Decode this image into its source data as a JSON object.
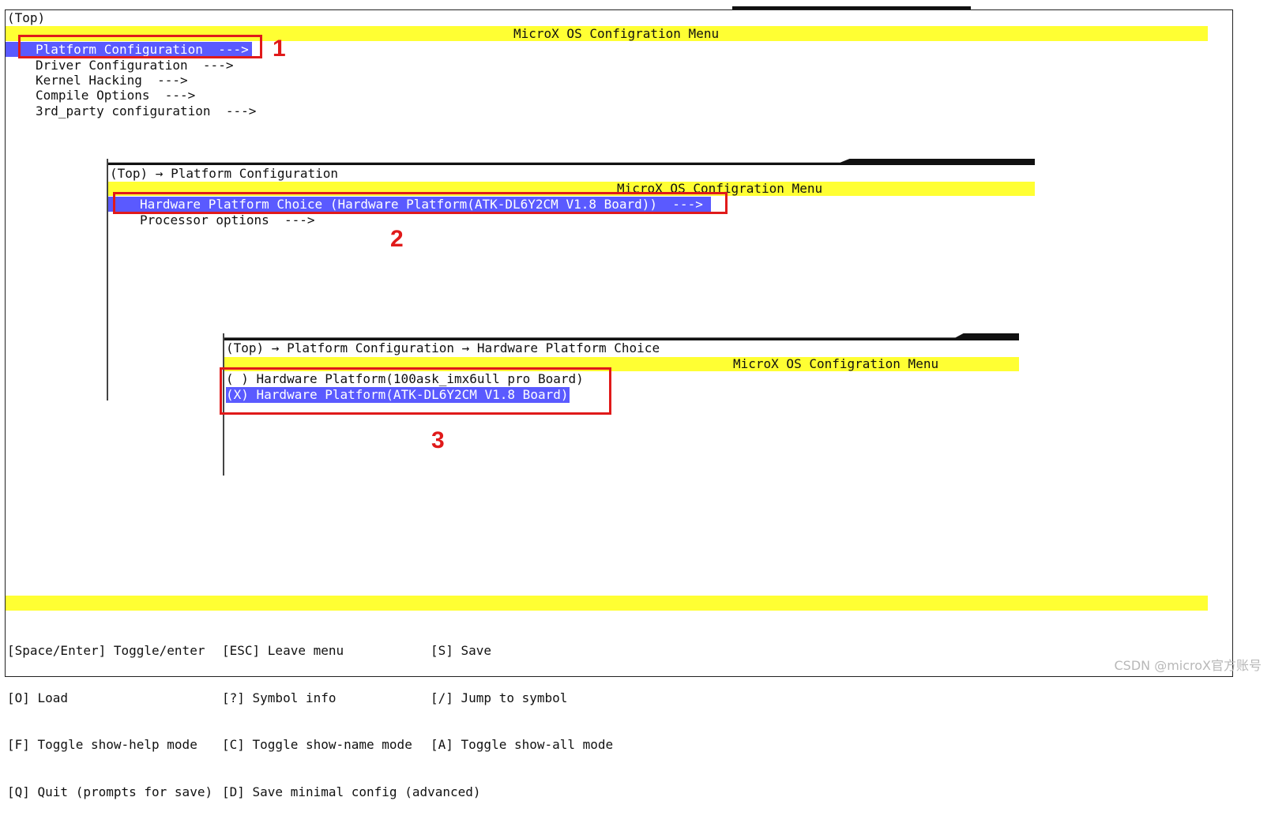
{
  "main": {
    "breadcrumb": "(Top)",
    "title": "MicroX OS Configration Menu",
    "menu": [
      "Platform Configuration  --->",
      "Driver Configuration  --->",
      "Kernel Hacking  --->",
      "Compile Options  --->",
      "3rd_party configuration  --->"
    ],
    "help": [
      [
        "[Space/Enter] Toggle/enter",
        "[ESC] Leave menu",
        "[S] Save"
      ],
      [
        "[O] Load",
        "[?] Symbol info",
        "[/] Jump to symbol"
      ],
      [
        "[F] Toggle show-help mode",
        "[C] Toggle show-name mode",
        "[A] Toggle show-all mode"
      ],
      [
        "[Q] Quit (prompts for save)",
        "[D] Save minimal config (advanced)",
        ""
      ]
    ]
  },
  "platform_menu": {
    "breadcrumb": "(Top) → Platform Configuration",
    "title": "MicroX OS Configration Menu",
    "items": [
      "Hardware Platform Choice (Hardware Platform(ATK-DL6Y2CM V1.8 Board))  --->",
      "Processor options  --->"
    ]
  },
  "hardware_choice": {
    "breadcrumb": "(Top) → Platform Configuration → Hardware Platform Choice",
    "title": "MicroX OS Configration Menu",
    "options": [
      "( ) Hardware Platform(100ask_imx6ull pro Board)",
      "(X) Hardware Platform(ATK-DL6Y2CM V1.8 Board)"
    ]
  },
  "annotations": {
    "step1": "1",
    "step2": "2",
    "step3": "3",
    "color": "#e01a1a"
  },
  "watermark": "CSDN @microX官方账号",
  "colors": {
    "title_bar": "#ffff33",
    "selection": "#5a5aff"
  }
}
